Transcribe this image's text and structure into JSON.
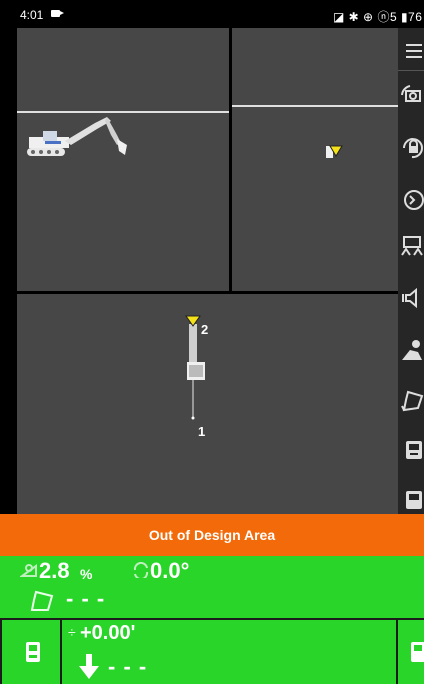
{
  "status_bar": {
    "time": "4:01",
    "right_icons": "◪ ✱ ⊕ ⓝ5 ▮76"
  },
  "viewports": {
    "plan": {
      "label_1": "1",
      "label_2": "2"
    }
  },
  "toolbar": {
    "items": [
      "menu-icon",
      "camera-rotate-icon",
      "lock-rotate-icon",
      "target-icon",
      "excavator-track-icon",
      "speaker-icon",
      "surveyor-icon",
      "bucket-icon",
      "gps-device-icon",
      "gps-device-icon"
    ]
  },
  "banner": {
    "text": "Out of Design Area"
  },
  "readouts": {
    "grade_value": "2.8",
    "grade_unit": "%",
    "rotation_value": "0.0°",
    "bucket_value": "- - -",
    "elevation_symbol": "÷",
    "elevation_value": "+0.00'",
    "cut_fill_value": "- - -"
  },
  "colors": {
    "panel_bg": "#474747",
    "banner": "#f26a0a",
    "readout_green": "#2ad52a",
    "marker_yellow": "#f5e11a"
  }
}
